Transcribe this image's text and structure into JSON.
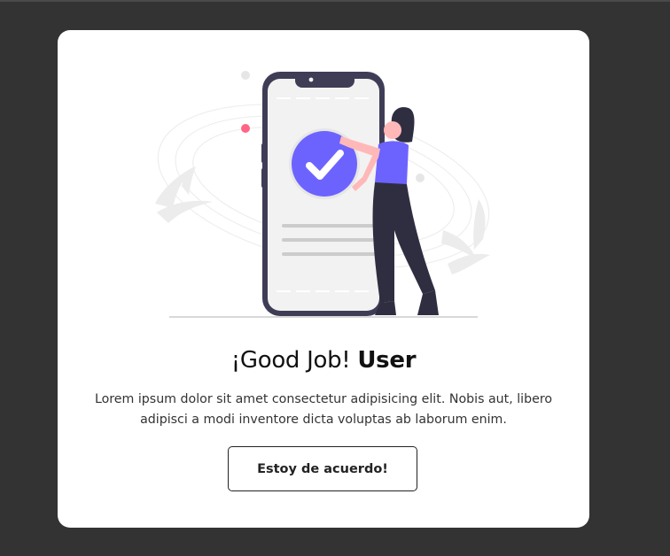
{
  "dialog": {
    "title_prefix": "¡Good Job!",
    "title_name": "User",
    "description": "Lorem ipsum dolor sit amet consectetur adipisicing elit. Nobis aut, libero adipisci a modi inventore dicta voluptas ab laborum enim.",
    "button_label": "Estoy de acuerdo!"
  },
  "illustration": {
    "icon": "check-circle-icon",
    "subject": "woman-with-phone"
  },
  "colors": {
    "page_background": "#333333",
    "card_background": "#ffffff",
    "accent": "#6c63ff",
    "phone_frame": "#3f3d56"
  }
}
